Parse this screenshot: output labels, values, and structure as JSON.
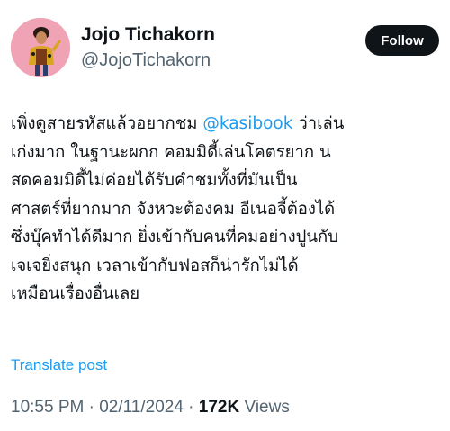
{
  "author": {
    "display_name": "Jojo Tichakorn",
    "handle": "@JojoTichakorn",
    "follow_label": "Follow"
  },
  "tweet": {
    "lines": [
      {
        "before": "เพิ่งดูสายรหัสแล้วอยากชม ",
        "mention": "@kasibook",
        "after": " ว่าเล่น"
      },
      {
        "text": "เก่งมาก ในฐานะผกก คอมมิดี้เล่นโคตรยาก น"
      },
      {
        "text": "สดคอมมิดี้ไม่ค่อยได้รับคำชมทั้งที่มันเป็น"
      },
      {
        "text": "ศาสตร์ที่ยากมาก จังหวะต้องคม อีเนอจี้ต้องได้"
      },
      {
        "text": "ซึ่งบุ๊คทำได้ดีมาก ยิ่งเข้ากับคนที่คมอย่างปูนกับ"
      },
      {
        "text": "เจเจยิ่งสนุก เวลาเข้ากับฟอสก็น่ารักไม่ได้"
      },
      {
        "text": "เหมือนเรื่องอื่นเลย"
      }
    ],
    "translate_label": "Translate post",
    "time": "10:55 PM",
    "separator": " · ",
    "date": "02/11/2024",
    "views_count": "172K",
    "views_label": " Views"
  },
  "colors": {
    "accent": "#1d9bf0",
    "text": "#0f1419",
    "muted": "#536471",
    "avatar_bg": "#f1a3b6"
  }
}
